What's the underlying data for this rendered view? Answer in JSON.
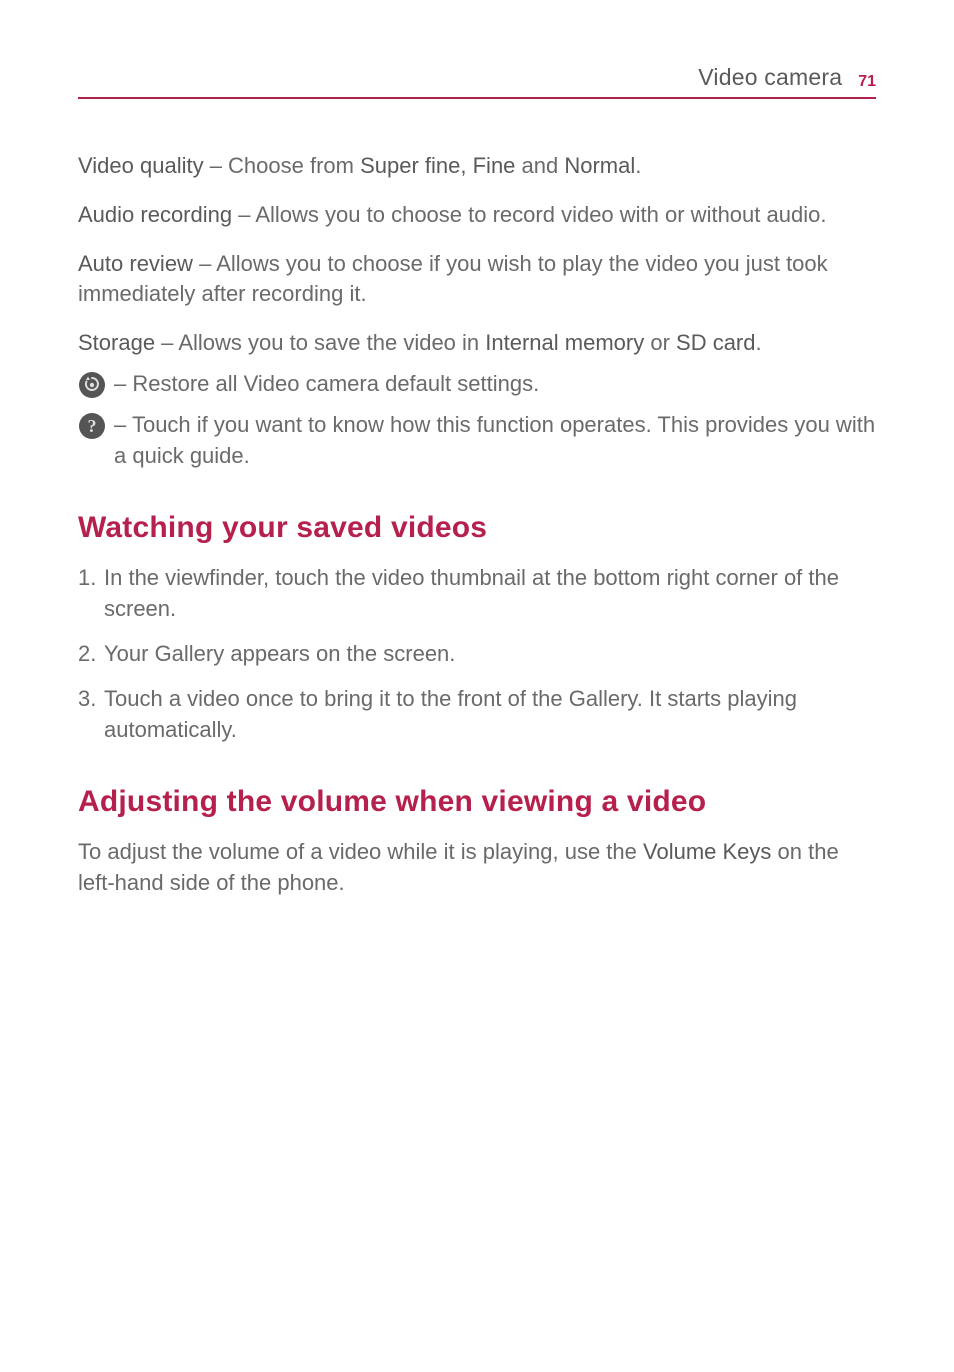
{
  "header": {
    "title": "Video camera",
    "page_number": "71"
  },
  "settings": {
    "video_quality": {
      "label": "Video quality",
      "sep": " – ",
      "prefix": "Choose from ",
      "opt1": "Super fine, Fine",
      "mid": " and ",
      "opt2": "Normal",
      "suffix": "."
    },
    "audio_recording": {
      "label": "Audio recording",
      "sep": " – ",
      "text": "Allows you to choose to record video with or without audio."
    },
    "auto_review": {
      "label": "Auto review",
      "sep": " – ",
      "text": "Allows you to choose if you wish to play the video you just took immediately after recording it."
    },
    "storage": {
      "label": "Storage",
      "sep": " – ",
      "prefix": "Allows you to save the video in ",
      "opt1": "Internal memory",
      "mid": " or ",
      "opt2": "SD card",
      "suffix": "."
    },
    "restore": {
      "sep": " – ",
      "text": "Restore all Video camera default settings."
    },
    "help": {
      "sep": " – ",
      "text": "Touch if you want to know how this function operates. This provides you with a quick guide."
    }
  },
  "watching": {
    "heading": "Watching your saved videos",
    "items": [
      {
        "num": "1.",
        "text": "In the viewfinder, touch the video thumbnail at the bottom right corner of the screen."
      },
      {
        "num": "2.",
        "text": "Your Gallery appears on the screen."
      },
      {
        "num": "3.",
        "text": "Touch a video once to bring it to the front of the Gallery. It starts playing automatically."
      }
    ]
  },
  "adjusting": {
    "heading": "Adjusting the volume when viewing a video",
    "prefix": "To adjust the volume of a video while it is playing, use the ",
    "bold": "Volume Keys",
    "suffix": " on the left-hand side of the phone."
  }
}
